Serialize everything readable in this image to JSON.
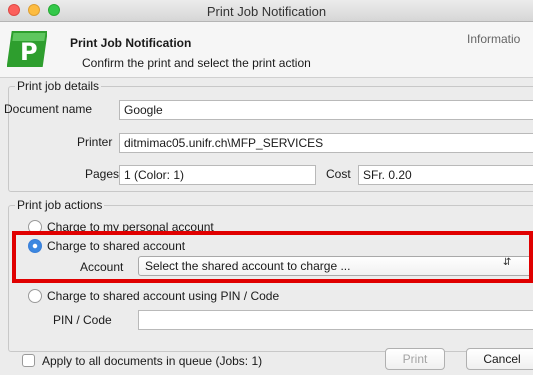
{
  "window": {
    "title": "Print Job Notification"
  },
  "header": {
    "title": "Print Job Notification",
    "subtitle": "Confirm the print and select the print action",
    "right_text": "Informatio"
  },
  "details": {
    "legend": "Print job details",
    "document_label": "Document name",
    "document_value": "Google",
    "printer_label": "Printer",
    "printer_value": "ditmimac05.unifr.ch\\MFP_SERVICES",
    "pages_label": "Pages",
    "pages_value": "1  (Color: 1)",
    "cost_label": "Cost",
    "cost_value": "SFr. 0.20"
  },
  "actions": {
    "legend": "Print job actions",
    "personal_label": "Charge to my personal account",
    "shared_label": "Charge to shared account",
    "account_label": "Account",
    "account_select": "Select the shared account to charge ...",
    "shared_pin_label": "Charge to shared account using PIN / Code",
    "pin_label": "PIN / Code",
    "selected": "shared"
  },
  "footer": {
    "apply_all_label": "Apply to all documents in queue (Jobs: 1)",
    "print_button": "Print",
    "cancel_button": "Cancel"
  },
  "colors": {
    "highlight": "#e00000",
    "logo_green": "#2e9e2e",
    "radio_selected": "#3b87e0"
  }
}
